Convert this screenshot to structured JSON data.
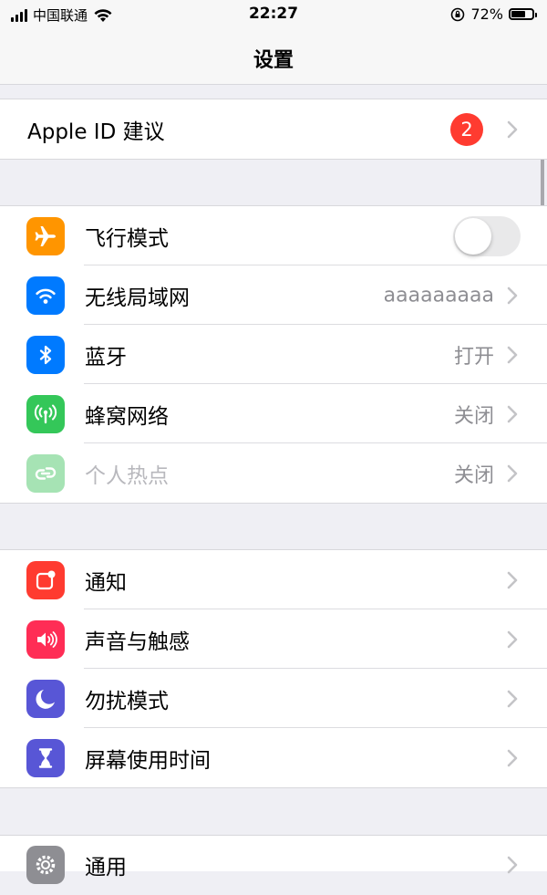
{
  "status_bar": {
    "carrier": "中国联通",
    "time": "22:27",
    "battery": "72%",
    "battery_level": 0.72
  },
  "nav": {
    "title": "设置"
  },
  "apple_id": {
    "label": "Apple ID 建议",
    "badge": "2"
  },
  "connectivity": {
    "airplane": {
      "label": "飞行模式",
      "enabled": false,
      "color": "#ff9500"
    },
    "wifi": {
      "label": "无线局域网",
      "value": "aaaaaaaaa",
      "color": "#007aff"
    },
    "bluetooth": {
      "label": "蓝牙",
      "value": "打开",
      "color": "#007aff"
    },
    "cellular": {
      "label": "蜂窝网络",
      "value": "关闭",
      "color": "#34c759"
    },
    "hotspot": {
      "label": "个人热点",
      "value": "关闭",
      "color": "#a6e3b4"
    }
  },
  "notifications_group": {
    "notifications": {
      "label": "通知",
      "color": "#ff3b30"
    },
    "sounds": {
      "label": "声音与触感",
      "color": "#ff2d55"
    },
    "dnd": {
      "label": "勿扰模式",
      "color": "#5856d6"
    },
    "screen_time": {
      "label": "屏幕使用时间",
      "color": "#5856d6"
    }
  },
  "general_group": {
    "general": {
      "label": "通用",
      "color": "#8e8e93"
    }
  }
}
